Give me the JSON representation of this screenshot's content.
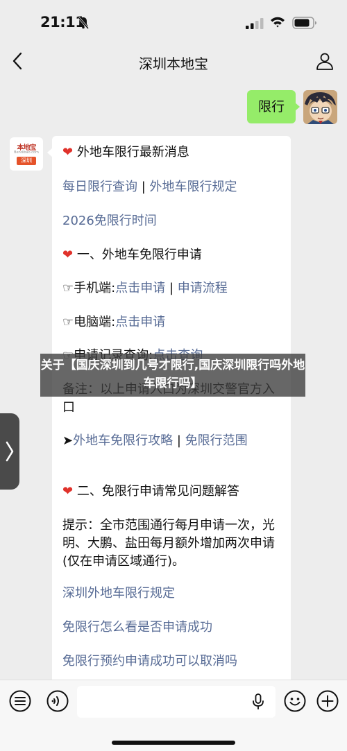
{
  "status_bar": {
    "time": "21:11"
  },
  "nav": {
    "title": "深圳本地宝"
  },
  "user_message": {
    "text": "限行"
  },
  "bot_avatar": {
    "logo_text": "本地宝",
    "logo_sub": "Bendibao.com",
    "badge": "深圳"
  },
  "bot_message": {
    "heading": "外地车限行最新消息",
    "link_daily": "每日限行查询",
    "separator": "|",
    "link_rules": "外地车限行规定",
    "link_2026": "2026免限行时间",
    "section1": "一、外地车免限行申请",
    "mobile_prefix": "☞手机端:",
    "mobile_link1": "点击申请",
    "mobile_link2": "申请流程",
    "pc_prefix": "☞电脑端:",
    "pc_link": "点击申请",
    "record_prefix": "☞申请记录查询:",
    "record_link": "点击查询",
    "note": "备注：以上申请入口为深圳交警官方入口",
    "guide_prefix": "➤",
    "guide_link1": "外地车免限行攻略",
    "guide_link2": "免限行范围",
    "section2": "二、免限行申请常见问题解答",
    "tip": "提示：全市范围通行每月申请一次，光明、大鹏、盐田每月额外增加两次申请 (仅在申请区域通行)。",
    "faq1": "深圳外地车限行规定",
    "faq2": "免限行怎么看是否申请成功",
    "faq3": "免限行预约申请成功可以取消吗"
  },
  "overlay": {
    "text": "关于【国庆深圳到几号才限行,国庆深圳限行吗外地车限行吗】"
  },
  "colors": {
    "link": "#576b95",
    "bubble_green": "#95ec69",
    "heart": "#e0322b"
  }
}
